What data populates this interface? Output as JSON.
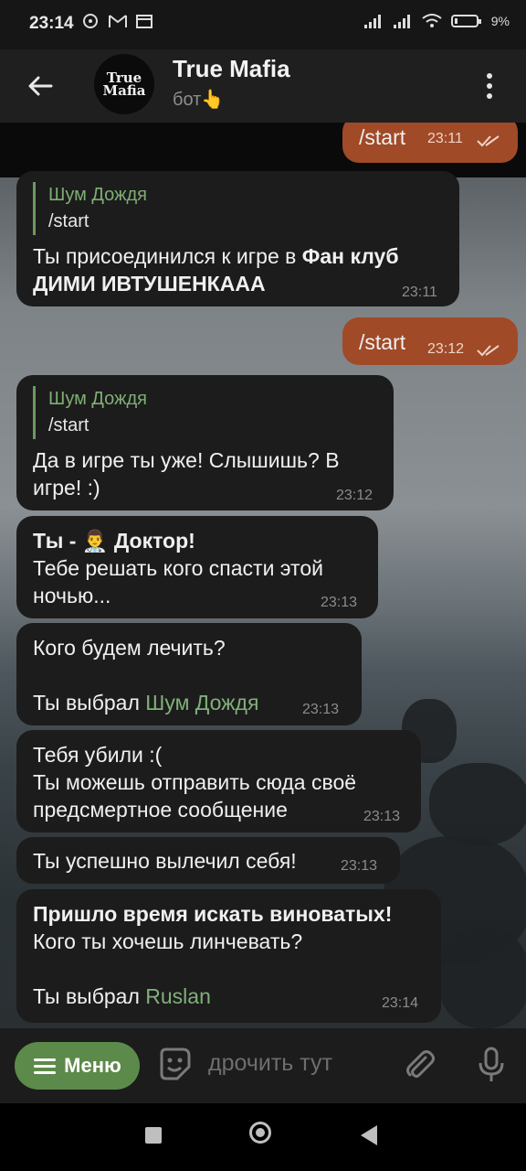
{
  "status_bar": {
    "time": "23:14",
    "battery": "9%"
  },
  "header": {
    "title": "True Mafia",
    "subtitle": "бот👆",
    "avatar_text": [
      "True",
      "Mafia"
    ]
  },
  "messages": [
    {
      "id": "m1",
      "dir": "out",
      "text": "/start",
      "time": "23:11"
    },
    {
      "id": "m2",
      "dir": "in",
      "reply_name": "Шум Дождя",
      "reply_text": "/start",
      "lines": [
        "Ты присоединился к игре в ",
        "Фан клуб",
        "ДИМИ ИВТУШЕНКААА"
      ],
      "time": "23:11"
    },
    {
      "id": "m3",
      "dir": "out",
      "text": "/start",
      "time": "23:12"
    },
    {
      "id": "m4",
      "dir": "in",
      "reply_name": "Шум Дождя",
      "reply_text": "/start",
      "lines": [
        "Да в игре ты уже! Слышишь? В",
        "игре! :)"
      ],
      "time": "23:12"
    },
    {
      "id": "m5",
      "dir": "in",
      "lines": [
        "Ты - 👨‍⚕️ Доктор!",
        "Тебе решать кого спасти этой",
        "ночью..."
      ],
      "time": "23:13"
    },
    {
      "id": "m6",
      "dir": "in",
      "lines": [
        "Кого будем лечить?",
        "Ты выбрал ",
        "Шум Дождя"
      ],
      "time": "23:13"
    },
    {
      "id": "m7",
      "dir": "in",
      "lines": [
        "Тебя убили :(",
        "Ты можешь отправить сюда своё",
        "предсмертное сообщение"
      ],
      "time": "23:13"
    },
    {
      "id": "m8",
      "dir": "in",
      "lines": [
        "Ты успешно вылечил себя!"
      ],
      "time": "23:13"
    },
    {
      "id": "m9",
      "dir": "in",
      "lines": [
        "Пришло время искать виноватых!",
        "Кого ты хочешь линчевать?",
        "Ты выбрал ",
        "Ruslan"
      ],
      "time": "23:14"
    }
  ],
  "input_bar": {
    "menu_label": "Меню",
    "placeholder": "дрочить тут"
  },
  "colors": {
    "outgoing": "#a04a28",
    "incoming": "#1c1c1c",
    "accent_green": "#5c8a4a"
  }
}
